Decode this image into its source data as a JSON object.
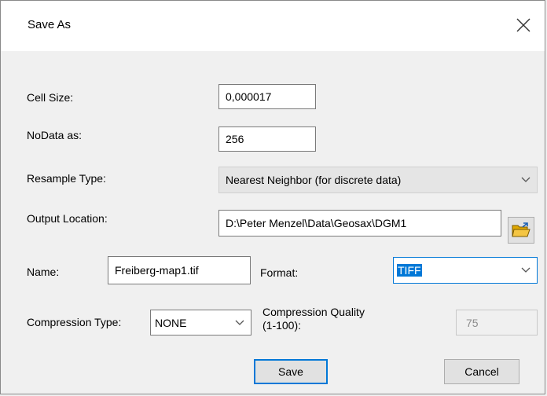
{
  "window": {
    "title": "Save As"
  },
  "fields": {
    "cell_size": {
      "label": "Cell Size:",
      "value": "0,000017"
    },
    "nodata": {
      "label": "NoData as:",
      "value": "256"
    },
    "resample": {
      "label": "Resample Type:",
      "value": "Nearest Neighbor (for discrete data)"
    },
    "output_location": {
      "label": "Output Location:",
      "value": "D:\\Peter Menzel\\Data\\Geosax\\DGM1"
    },
    "name": {
      "label": "Name:",
      "value": "Freiberg-map1.tif"
    },
    "format": {
      "label": "Format:",
      "value": "TIFF"
    },
    "compression_type": {
      "label": "Compression Type:",
      "value": "NONE"
    },
    "compression_quality": {
      "label_line1": "Compression Quality",
      "label_line2": "(1-100):",
      "value": "75"
    }
  },
  "buttons": {
    "save": "Save",
    "cancel": "Cancel"
  },
  "icons": {
    "close": "close-icon",
    "folder": "open-folder-icon",
    "chevron": "chevron-down-icon"
  },
  "colors": {
    "accent": "#0078d7",
    "folder_yellow": "#f4c542"
  }
}
